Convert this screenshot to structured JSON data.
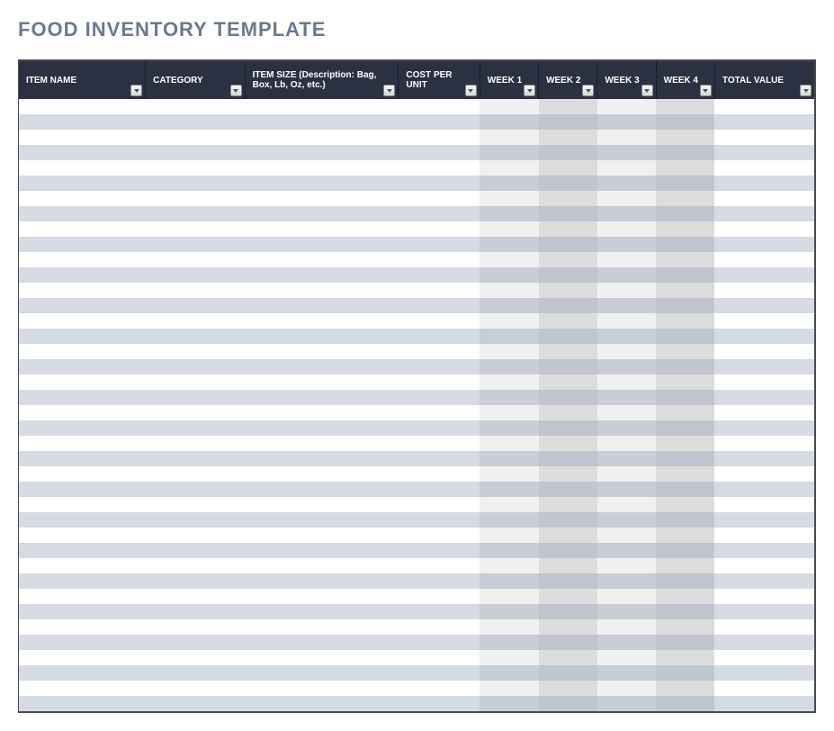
{
  "title": "FOOD INVENTORY  TEMPLATE",
  "columns": [
    {
      "label": "ITEM NAME",
      "class": "col-item"
    },
    {
      "label": "CATEGORY",
      "class": "col-cat"
    },
    {
      "label": "ITEM SIZE (Description: Bag, Box, Lb, Oz, etc.)",
      "class": "col-size"
    },
    {
      "label": "COST PER UNIT",
      "class": "col-cost"
    },
    {
      "label": "WEEK 1",
      "class": "col-wk"
    },
    {
      "label": "WEEK 2",
      "class": "col-wk"
    },
    {
      "label": "WEEK 3",
      "class": "col-wk"
    },
    {
      "label": "WEEK 4",
      "class": "col-wk"
    },
    {
      "label": "TOTAL VALUE",
      "class": "col-total"
    }
  ],
  "row_count": 40,
  "week_col_indices": [
    4,
    5,
    6,
    7
  ],
  "week_dark_indices": [
    5,
    7
  ]
}
